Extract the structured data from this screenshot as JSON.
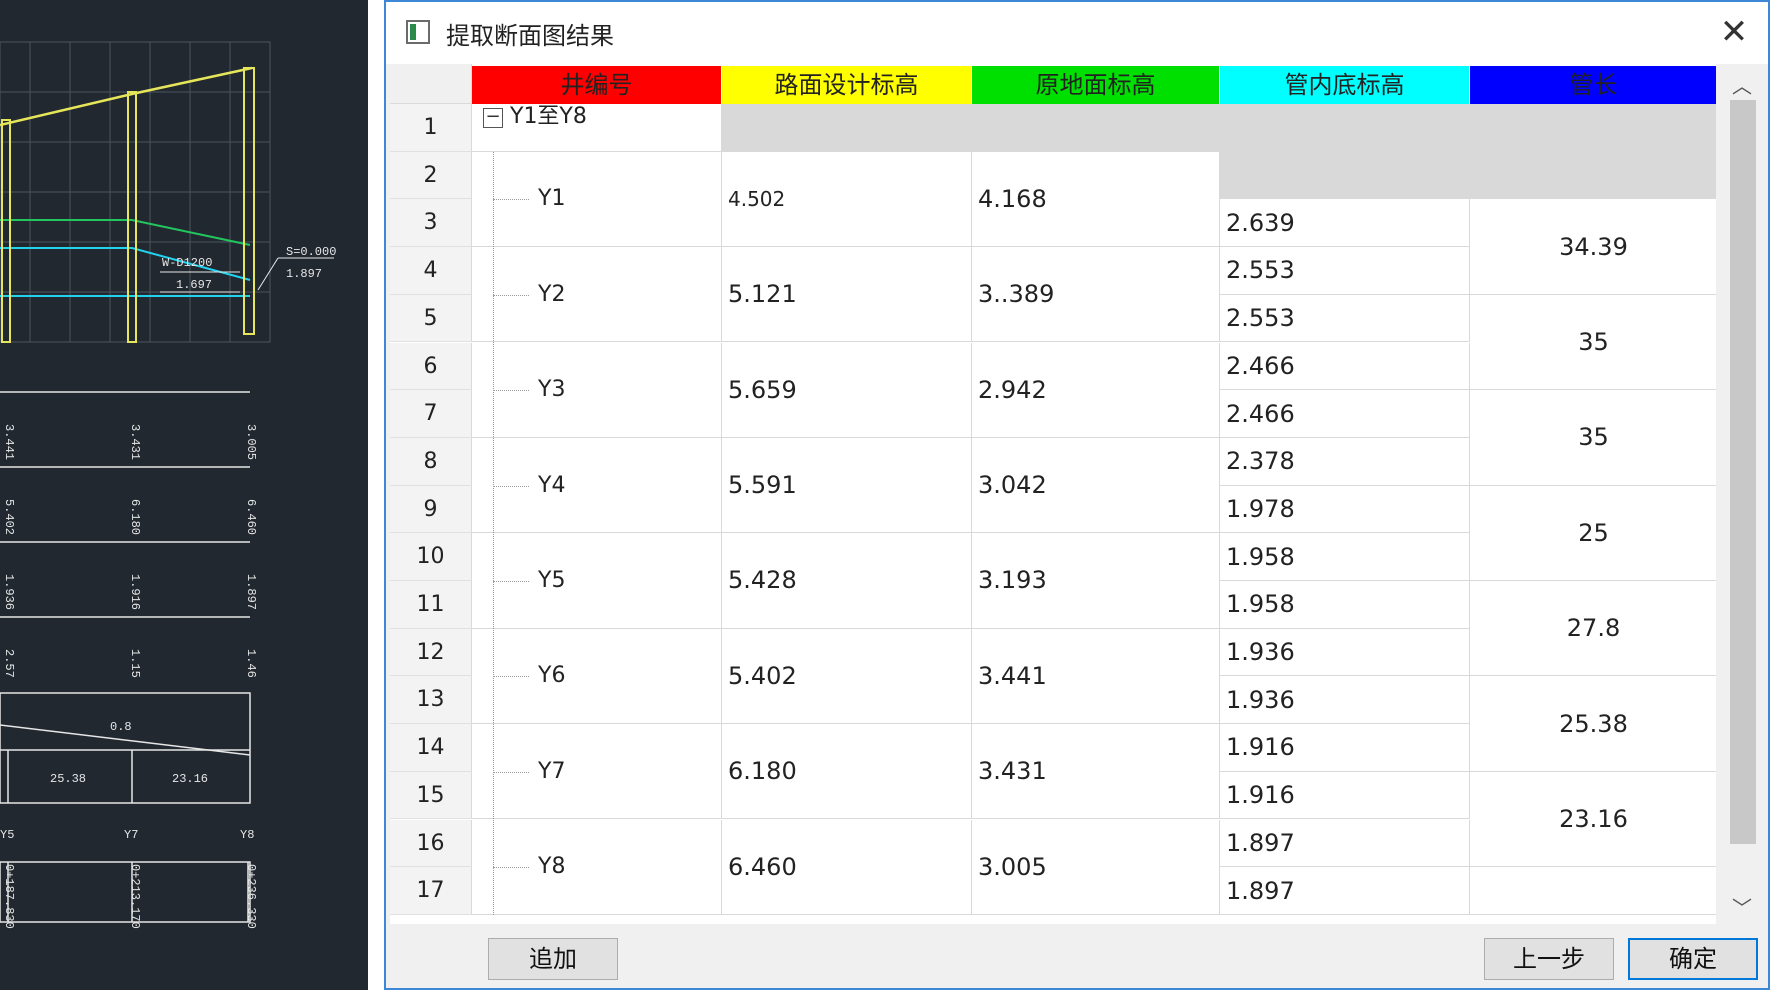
{
  "dialog": {
    "title": "提取断面图结果",
    "close_glyph": "✕"
  },
  "grid": {
    "columns": [
      "井编号",
      "路面设计标高",
      "原地面标高",
      "管内底标高",
      "管长"
    ],
    "column_colors": [
      "#ff0000",
      "#ffff00",
      "#00e000",
      "#00ffff",
      "#0000ff"
    ],
    "row_numbers": [
      "1",
      "2",
      "3",
      "4",
      "5",
      "6",
      "7",
      "8",
      "9",
      "10",
      "11",
      "12",
      "13",
      "14",
      "15",
      "16",
      "17"
    ],
    "group": {
      "toggle": "−",
      "label": "Y1至Y8"
    },
    "wells": [
      {
        "id": "Y1",
        "design_elev": "4.502",
        "ground_elev": "4.168"
      },
      {
        "id": "Y2",
        "design_elev": "5.121",
        "ground_elev": "3..389"
      },
      {
        "id": "Y3",
        "design_elev": "5.659",
        "ground_elev": "2.942"
      },
      {
        "id": "Y4",
        "design_elev": "5.591",
        "ground_elev": "3.042"
      },
      {
        "id": "Y5",
        "design_elev": "5.428",
        "ground_elev": "3.193"
      },
      {
        "id": "Y6",
        "design_elev": "5.402",
        "ground_elev": "3.441"
      },
      {
        "id": "Y7",
        "design_elev": "6.180",
        "ground_elev": "3.431"
      },
      {
        "id": "Y8",
        "design_elev": "6.460",
        "ground_elev": "3.005"
      }
    ],
    "invert_elevations": [
      "2.639",
      "2.553",
      "2.553",
      "2.466",
      "2.466",
      "2.378",
      "1.978",
      "1.958",
      "1.958",
      "1.936",
      "1.936",
      "1.916",
      "1.916",
      "1.897",
      "1.897"
    ],
    "pipe_lengths": [
      "34.39",
      "35",
      "35",
      "25",
      "27.8",
      "25.38",
      "23.16"
    ]
  },
  "scrollbar": {
    "up_glyph": "︿",
    "down_glyph": "﹀"
  },
  "buttons": {
    "add": "追加",
    "prev": "上一步",
    "ok": "确定"
  },
  "cad": {
    "labels": [
      "S=0.000",
      "1.897",
      "W-D1200",
      "1.697",
      "0.8",
      "25.38",
      "23.16",
      "Y5",
      "Y7",
      "Y8",
      "3.441",
      "3.431",
      "3.005",
      "5.402",
      "6.180",
      "6.460",
      "1.936",
      "1.916",
      "1.897",
      "2.57",
      "1.15",
      "1.46",
      "0+187.830",
      "0+213.170",
      "0+236.330"
    ]
  }
}
